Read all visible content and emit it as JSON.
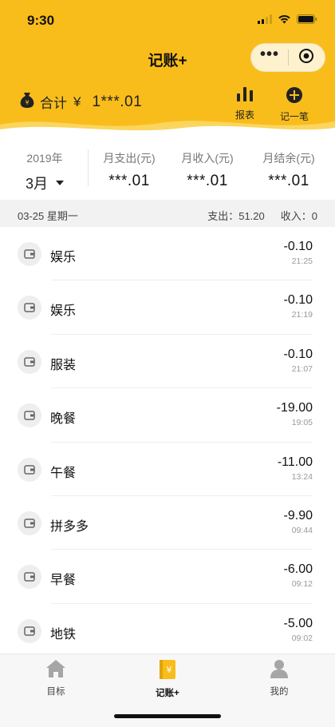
{
  "status": {
    "time": "9:30"
  },
  "header": {
    "title": "记账+",
    "capsule": {
      "more": "•••"
    },
    "total_label": "合计",
    "currency": "¥",
    "total_value": "1***.01",
    "actions": [
      {
        "label": "报表",
        "icon": "bar-chart-icon"
      },
      {
        "label": "记一笔",
        "icon": "plus-circle-icon"
      }
    ],
    "accent": "#f9bd1b"
  },
  "summary": {
    "year": "2019年",
    "month": "3月",
    "columns": [
      {
        "label": "月支出(元)",
        "value": "***.01"
      },
      {
        "label": "月收入(元)",
        "value": "***.01"
      },
      {
        "label": "月结余(元)",
        "value": "***.01"
      }
    ]
  },
  "day": {
    "date": "03-25 星期一",
    "expense": "支出：51.20",
    "income": "收入：0"
  },
  "records": [
    {
      "name": "娱乐",
      "amount": "-0.10",
      "time": "21:25"
    },
    {
      "name": "娱乐",
      "amount": "-0.10",
      "time": "21:19"
    },
    {
      "name": "服装",
      "amount": "-0.10",
      "time": "21:07"
    },
    {
      "name": "晚餐",
      "amount": "-19.00",
      "time": "19:05"
    },
    {
      "name": "午餐",
      "amount": "-11.00",
      "time": "13:24"
    },
    {
      "name": "拼多多",
      "amount": "-9.90",
      "time": "09:44"
    },
    {
      "name": "早餐",
      "amount": "-6.00",
      "time": "09:12"
    },
    {
      "name": "地铁",
      "amount": "-5.00",
      "time": "09:02"
    }
  ],
  "tabs": [
    {
      "label": "目标",
      "icon": "home-icon"
    },
    {
      "label": "记账+",
      "icon": "yen-book-icon",
      "active": true
    },
    {
      "label": "我的",
      "icon": "user-icon"
    }
  ]
}
